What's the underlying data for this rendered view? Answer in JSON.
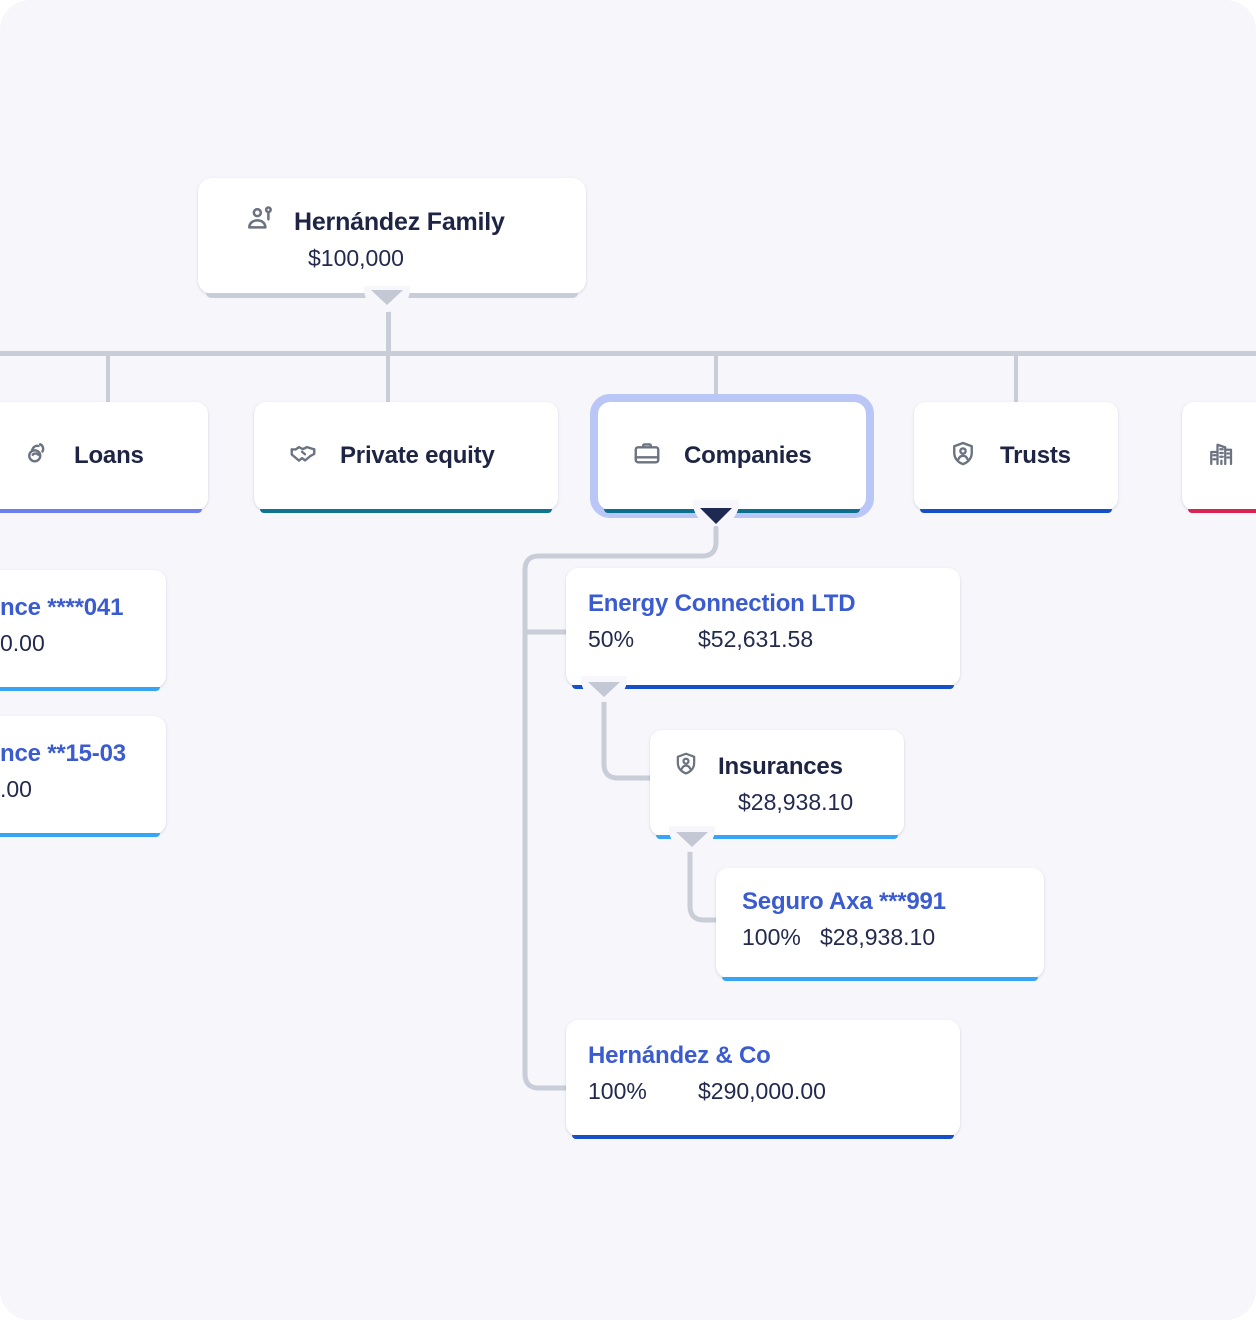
{
  "theme": {
    "page_bg": "#f6f6fb",
    "card_bg": "#ffffff",
    "title_navy": "#1e2444",
    "entity_blue": "#3b5bd0",
    "connector_grey": "#c9cdd8",
    "selection_ring": "#bac6f6"
  },
  "root": {
    "icon": "family-people-icon",
    "title": "Hernández Family",
    "amount": "$100,000",
    "accent_color": "#c9cdd8",
    "collapse_icon": "triangle-down-icon"
  },
  "categories": [
    {
      "id": "loans",
      "icon": "hand-coin-icon",
      "label": "Loans",
      "accent_color": "#6d7ff0",
      "selected": false,
      "clipped": "left"
    },
    {
      "id": "private-equity",
      "icon": "handshake-icon",
      "label": "Private equity",
      "accent_color": "#0e7490",
      "selected": false,
      "clipped": "none"
    },
    {
      "id": "companies",
      "icon": "briefcase-icon",
      "label": "Companies",
      "accent_color": "#0e6f8c",
      "selected": true,
      "clipped": "none",
      "collapse_icon": "triangle-down-icon"
    },
    {
      "id": "trusts",
      "icon": "shield-person-icon",
      "label": "Trusts",
      "accent_color": "#1550c8",
      "selected": false,
      "clipped": "none"
    },
    {
      "id": "real-estate",
      "icon": "buildings-icon",
      "label": "",
      "accent_color": "#d92353",
      "selected": false,
      "clipped": "right"
    }
  ],
  "left_clipped_accounts": [
    {
      "id": "account-041",
      "title": "nce ****041",
      "amount": "0.00",
      "accent_color": "#36a5f5"
    },
    {
      "id": "account-15-03",
      "title": "nce **15-03",
      "amount": ".00",
      "accent_color": "#36a5f5"
    }
  ],
  "companies_tree": [
    {
      "id": "energy-connection-ltd",
      "kind": "entity",
      "title": "Energy Connection LTD",
      "percent": "50%",
      "amount": "$52,631.58",
      "accent_color": "#1550c8",
      "collapse_icon": "triangle-down-icon"
    },
    {
      "id": "insurances",
      "kind": "group",
      "icon": "shield-person-icon",
      "title": "Insurances",
      "amount": "$28,938.10",
      "accent_color": "#36a5f5",
      "collapse_icon": "triangle-down-icon"
    },
    {
      "id": "seguro-axa-991",
      "kind": "entity",
      "title": "Seguro Axa ***991",
      "percent": "100%",
      "amount": "$28,938.10",
      "accent_color": "#36a5f5"
    },
    {
      "id": "hernandez-co",
      "kind": "entity",
      "title": "Hernández & Co",
      "percent": "100%",
      "amount": "$290,000.00",
      "accent_color": "#1550c8"
    }
  ]
}
